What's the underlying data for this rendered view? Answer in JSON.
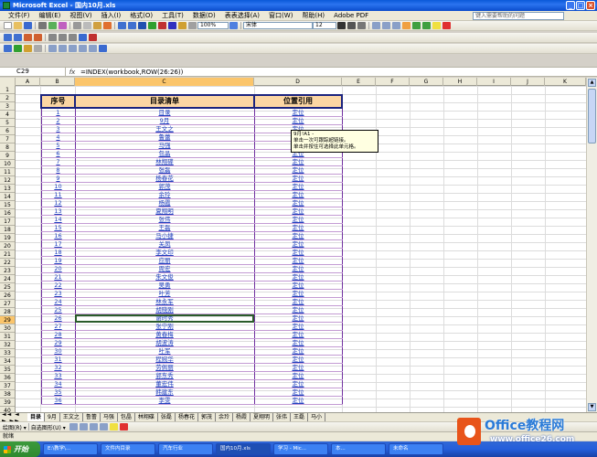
{
  "window": {
    "title": "Microsoft Excel - 国内10月.xls",
    "min": "_",
    "max": "□",
    "close": "×"
  },
  "menu": {
    "items": [
      "文件(F)",
      "编辑(E)",
      "视图(V)",
      "插入(I)",
      "格式(O)",
      "工具(T)",
      "数据(D)",
      "表表选择(A)",
      "窗口(W)",
      "帮助(H)",
      "Adobe PDF"
    ],
    "help_placeholder": "键入需要帮助的问题"
  },
  "toolbar": {
    "zoom": "100%",
    "font_name": "宋体",
    "font_size": "12"
  },
  "formula_bar": {
    "name_box": "C29",
    "fx": "fx",
    "formula": "=INDEX(workbook,ROW(26:26))"
  },
  "columns": [
    "A",
    "B",
    "C",
    "D",
    "E",
    "F",
    "G",
    "H",
    "I",
    "J",
    "K"
  ],
  "rows": [
    "1",
    "2",
    "3",
    "4",
    "5",
    "6",
    "7",
    "8",
    "9",
    "10",
    "11",
    "12",
    "13",
    "14",
    "15",
    "16",
    "17",
    "18",
    "19",
    "20",
    "21",
    "22",
    "23",
    "24",
    "25",
    "26",
    "27",
    "28",
    "29",
    "30",
    "31",
    "32",
    "33",
    "34",
    "35",
    "36",
    "37",
    "38",
    "39",
    "40",
    "41"
  ],
  "table": {
    "headers": {
      "no": "序号",
      "name": "目录清单",
      "ref": "位置引用"
    },
    "rows": [
      {
        "no": "1",
        "name": "目录",
        "ref": "定位"
      },
      {
        "no": "2",
        "name": "9月",
        "ref": "定位"
      },
      {
        "no": "3",
        "name": "王文之",
        "ref": "定位"
      },
      {
        "no": "4",
        "name": "鲁蕾",
        "ref": "定位"
      },
      {
        "no": "5",
        "name": "马强",
        "ref": "定位"
      },
      {
        "no": "6",
        "name": "包晶",
        "ref": "定位"
      },
      {
        "no": "7",
        "name": "林翔碟",
        "ref": "定位"
      },
      {
        "no": "8",
        "name": "张磊",
        "ref": "定位"
      },
      {
        "no": "9",
        "name": "杨春花",
        "ref": "定位"
      },
      {
        "no": "10",
        "name": "郭茂",
        "ref": "定位"
      },
      {
        "no": "11",
        "name": "余玲",
        "ref": "定位"
      },
      {
        "no": "12",
        "name": "杨霞",
        "ref": "定位"
      },
      {
        "no": "13",
        "name": "夏翔明",
        "ref": "定位"
      },
      {
        "no": "14",
        "name": "张伟",
        "ref": "定位"
      },
      {
        "no": "15",
        "name": "王磊",
        "ref": "定位"
      },
      {
        "no": "16",
        "name": "马小捷",
        "ref": "定位"
      },
      {
        "no": "17",
        "name": "关凤",
        "ref": "定位"
      },
      {
        "no": "18",
        "name": "李文印",
        "ref": "定位"
      },
      {
        "no": "19",
        "name": "应丽",
        "ref": "定位"
      },
      {
        "no": "20",
        "name": "周宏",
        "ref": "定位"
      },
      {
        "no": "21",
        "name": "朱文俊",
        "ref": "定位"
      },
      {
        "no": "22",
        "name": "吴勇",
        "ref": "定位"
      },
      {
        "no": "23",
        "name": "叶芳",
        "ref": "定位"
      },
      {
        "no": "24",
        "name": "林永军",
        "ref": "定位"
      },
      {
        "no": "25",
        "name": "胡晓刚",
        "ref": "定位"
      },
      {
        "no": "26",
        "name": "谢时秀",
        "ref": "定位"
      },
      {
        "no": "27",
        "name": "张宁刚",
        "ref": "定位"
      },
      {
        "no": "28",
        "name": "黄春梅",
        "ref": "定位"
      },
      {
        "no": "29",
        "name": "胡波涛",
        "ref": "定位"
      },
      {
        "no": "30",
        "name": "叶军",
        "ref": "定位"
      },
      {
        "no": "31",
        "name": "程婉华",
        "ref": "定位"
      },
      {
        "no": "32",
        "name": "劳佩丽",
        "ref": "定位"
      },
      {
        "no": "33",
        "name": "郭东秀",
        "ref": "定位"
      },
      {
        "no": "34",
        "name": "董宏伟",
        "ref": "定位"
      },
      {
        "no": "35",
        "name": "韩建东",
        "ref": "定位"
      },
      {
        "no": "36",
        "name": "李雯",
        "ref": "定位"
      }
    ]
  },
  "tooltip": {
    "line1": "9月!A1 -",
    "line2": "单击一次可跟踪超链接。",
    "line3": "单击并按住可选择此单元格。"
  },
  "sheet_tabs": [
    "目录",
    "9月",
    "王文之",
    "鲁蕾",
    "马强",
    "包晶",
    "林翔碟",
    "张磊",
    "杨春花",
    "郭茂",
    "余玲",
    "杨霞",
    "夏翔明",
    "张伟",
    "王磊",
    "马小"
  ],
  "sheet_nav": "◄◄ ◄ ► ►►",
  "drawbar": {
    "draw": "绘图(R) ▾",
    "autoshapes": "自选图形(U) ▾"
  },
  "status": "就绪",
  "taskbar": {
    "start": "开始",
    "items": [
      "E:\\教学\\...",
      "文件内目录",
      "汽车行业",
      "国内10月.xls",
      "学习 - Mic...",
      "本...",
      "未命名"
    ]
  },
  "watermark": {
    "title": "Office教程网",
    "url": "www.office26.com"
  }
}
